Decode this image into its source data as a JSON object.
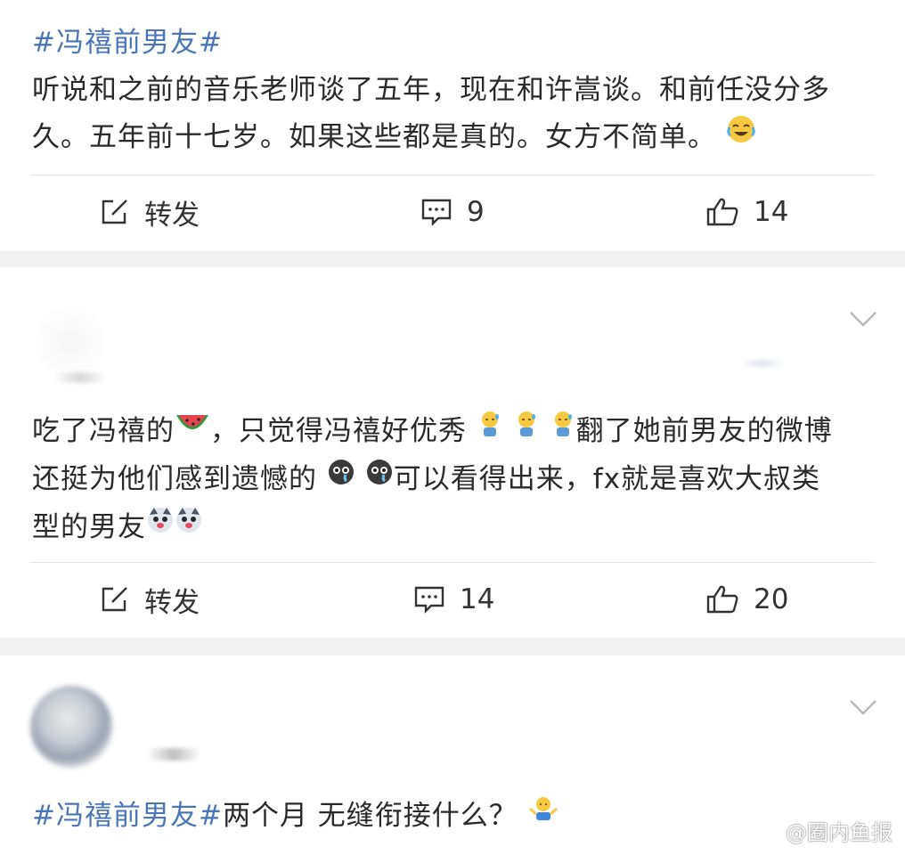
{
  "posts": [
    {
      "topic": "#冯禧前男友#",
      "line1": "听说和之前的音乐老师谈了五年，现在和许嵩谈。和前任没分多",
      "line2": "久。五年前十七岁。如果这些都是真的。女方不简单。",
      "repost_label": "转发",
      "comment_count": "9",
      "like_count": "14"
    },
    {
      "line1_a": "吃了冯禧的",
      "line1_b": "，只觉得冯禧好优秀",
      "line1_c": "翻了她前男友的微博",
      "line2_a": "还挺为他们感到遗憾的",
      "line2_b": "可以看得出来，fx就是喜欢大叔类",
      "line3": "型的男友",
      "repost_label": "转发",
      "comment_count": "14",
      "like_count": "20"
    },
    {
      "topic": "#冯禧前男友#",
      "text": "两个月 无缝衔接什么？"
    }
  ],
  "watermark": "@圈内鱼报",
  "icons": {
    "repost": "edit-share-icon",
    "comment": "comment-bubble-icon",
    "like": "thumbs-up-icon",
    "expand": "chevron-down-icon"
  },
  "colors": {
    "topic": "#4a76b8",
    "separator": "#f2f2f2"
  }
}
